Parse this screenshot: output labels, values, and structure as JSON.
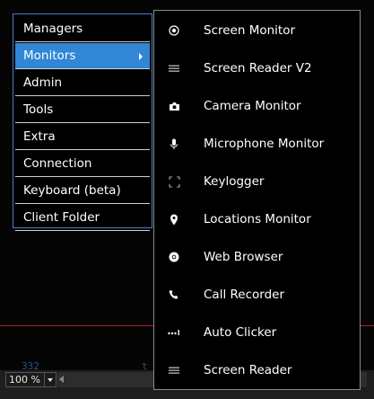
{
  "background": {
    "line_number": "332",
    "partial_text": "t"
  },
  "status_bar": {
    "zoom_value": "100 %"
  },
  "main_menu": {
    "items": [
      {
        "label": "Managers",
        "active": false,
        "has_submenu": false
      },
      {
        "label": "Monitors",
        "active": true,
        "has_submenu": true
      },
      {
        "label": "Admin",
        "active": false,
        "has_submenu": false
      },
      {
        "label": "Tools",
        "active": false,
        "has_submenu": false
      },
      {
        "label": "Extra",
        "active": false,
        "has_submenu": false
      },
      {
        "label": "Connection",
        "active": false,
        "has_submenu": false
      },
      {
        "label": "Keyboard (beta)",
        "active": false,
        "has_submenu": false
      },
      {
        "label": "Client Folder",
        "active": false,
        "has_submenu": false
      }
    ]
  },
  "submenu": {
    "items": [
      {
        "label": "Screen Monitor",
        "icon": "radio-dot-icon"
      },
      {
        "label": "Screen Reader V2",
        "icon": "lines-icon"
      },
      {
        "label": "Camera Monitor",
        "icon": "camera-icon"
      },
      {
        "label": "Microphone Monitor",
        "icon": "microphone-icon"
      },
      {
        "label": "Keylogger",
        "icon": "dashed-frame-icon"
      },
      {
        "label": "Locations Monitor",
        "icon": "location-pin-icon"
      },
      {
        "label": "Web Browser",
        "icon": "chrome-icon"
      },
      {
        "label": "Call Recorder",
        "icon": "phone-icon"
      },
      {
        "label": "Auto Clicker",
        "icon": "dots-cursor-icon"
      },
      {
        "label": "Screen Reader",
        "icon": "lines-icon"
      }
    ]
  },
  "colors": {
    "menu_border": "#4a7ec4",
    "active_item": "#3186d6",
    "submenu_border": "#8a8a8a",
    "red_line": "#b0202a"
  }
}
